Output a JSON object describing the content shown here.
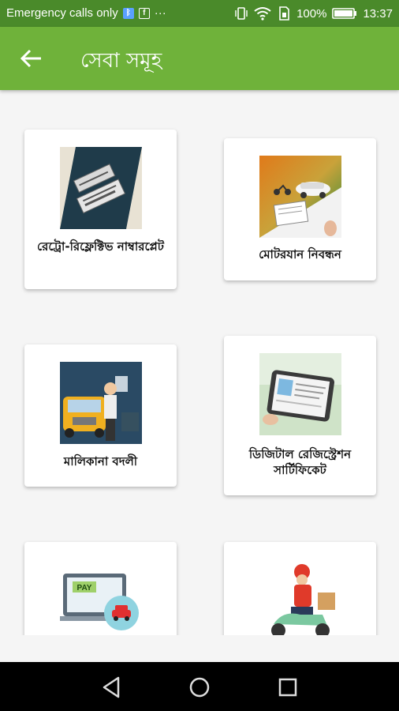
{
  "statusbar": {
    "carrier": "Emergency calls only",
    "battery": "100%",
    "time": "13:37"
  },
  "appbar": {
    "title": "সেবা সমূহ"
  },
  "services": [
    {
      "label": "রেট্রো-রিফ্লেক্টিভ নাম্বারপ্লেট",
      "icon": "retro-numberplate-icon"
    },
    {
      "label": "মোটরযান নিবন্ধন",
      "icon": "vehicle-registration-icon"
    },
    {
      "label": "মালিকানা বদলী",
      "icon": "ownership-transfer-icon"
    },
    {
      "label": "ডিজিটাল রেজিস্ট্রেশন সার্টিফিকেট",
      "icon": "digital-registration-certificate-icon"
    },
    {
      "label": "",
      "icon": "online-payment-icon",
      "pay_text": "PAY"
    },
    {
      "label": "",
      "icon": "delivery-icon"
    }
  ],
  "colors": {
    "statusbar": "#4a8a2a",
    "appbar": "#6fb23a",
    "background": "#f5f5f5"
  }
}
